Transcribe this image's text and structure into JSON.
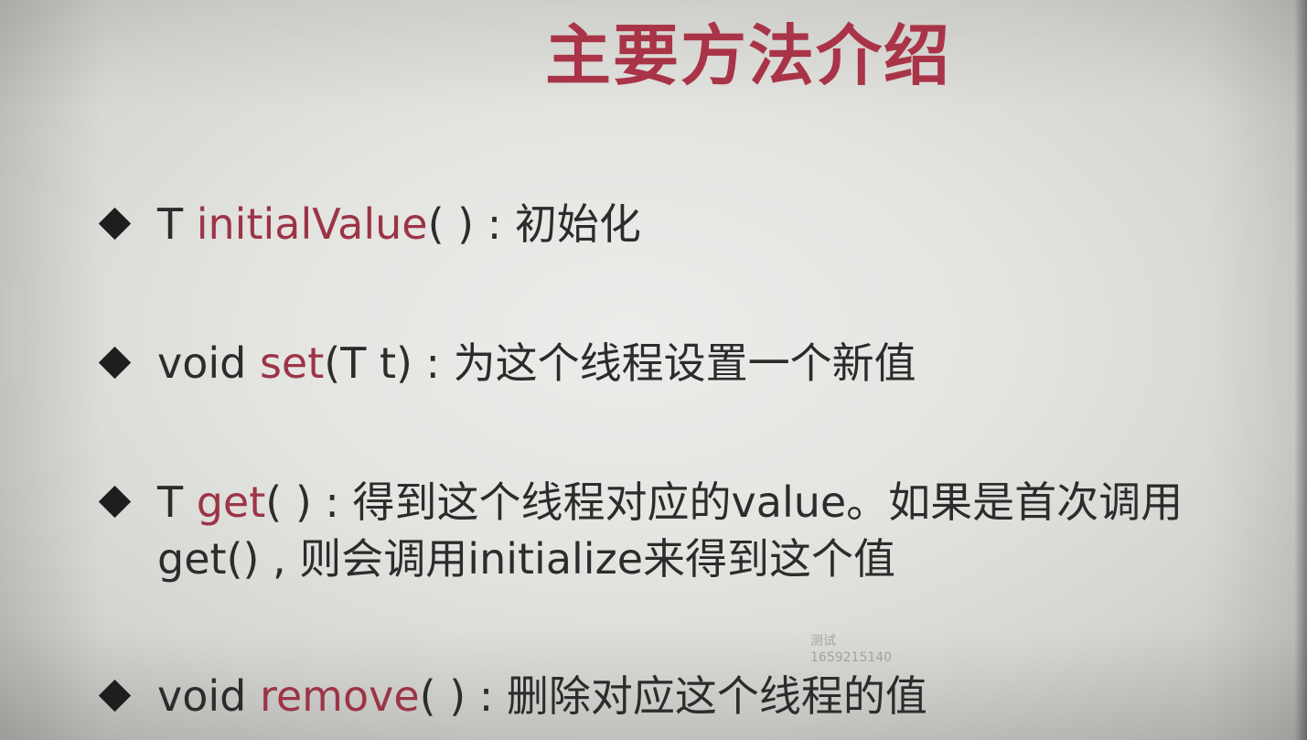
{
  "title": "主要方法介绍",
  "items": [
    {
      "prefix": "T ",
      "method": "initialValue",
      "signature_rest": "( ) : 初始化",
      "continuation": ""
    },
    {
      "prefix": "void ",
      "method": "set",
      "signature_rest": "(T t) : 为这个线程设置一个新值",
      "continuation": ""
    },
    {
      "prefix": "T ",
      "method": "get",
      "signature_rest": "( ) : 得到这个线程对应的value。如果是首次调用",
      "continuation": "get() , 则会调用initialize来得到这个值"
    },
    {
      "prefix": "void ",
      "method": "remove",
      "signature_rest": "( ) : 删除对应这个线程的值",
      "continuation": ""
    }
  ],
  "watermark": {
    "line1": "测试",
    "line2": "1659215140"
  },
  "colors": {
    "title": "#a93447",
    "method_name": "#9c3446",
    "text": "#2c2c2c",
    "background": "#e4e4e1"
  },
  "icons": {
    "bullet": "diamond-bullet-icon"
  }
}
